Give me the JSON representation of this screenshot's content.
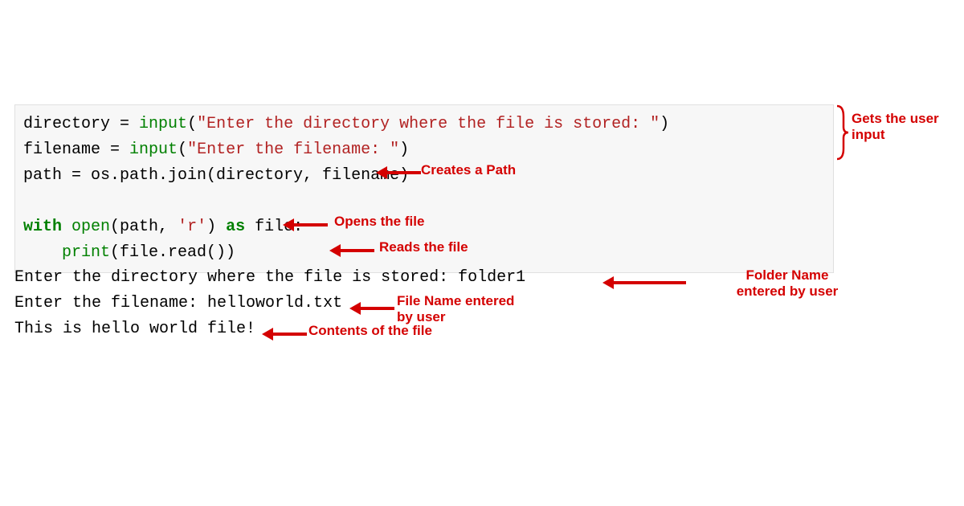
{
  "code": {
    "l1_var": "directory ",
    "l1_eq": "= ",
    "l1_fn": "input",
    "l1_p1": "(",
    "l1_str": "\"Enter the directory where the file is stored: \"",
    "l1_p2": ")",
    "l2_var": "filename ",
    "l2_eq": "= ",
    "l2_fn": "input",
    "l2_p1": "(",
    "l2_str": "\"Enter the filename: \"",
    "l2_p2": ")",
    "l3": "path = os.path.join(directory, filename)",
    "l5_with": "with",
    "l5_sp1": " ",
    "l5_open": "open",
    "l5_p1": "(path, ",
    "l5_str": "'r'",
    "l5_p2": ") ",
    "l5_as": "as",
    "l5_end": " file:",
    "l6_indent": "    ",
    "l6_print": "print",
    "l6_rest": "(file.read())"
  },
  "output": {
    "l1": "Enter the directory where the file is stored: folder1",
    "l2": "Enter the filename: helloworld.txt",
    "l3": "This is hello world file!"
  },
  "annotations": {
    "gets_input": "Gets the user input",
    "creates_path": "Creates a Path",
    "opens_file": "Opens the file",
    "reads_file": "Reads the file",
    "folder_name": "Folder Name entered by user",
    "file_name": "File Name entered by user",
    "contents": "Contents of the file"
  }
}
